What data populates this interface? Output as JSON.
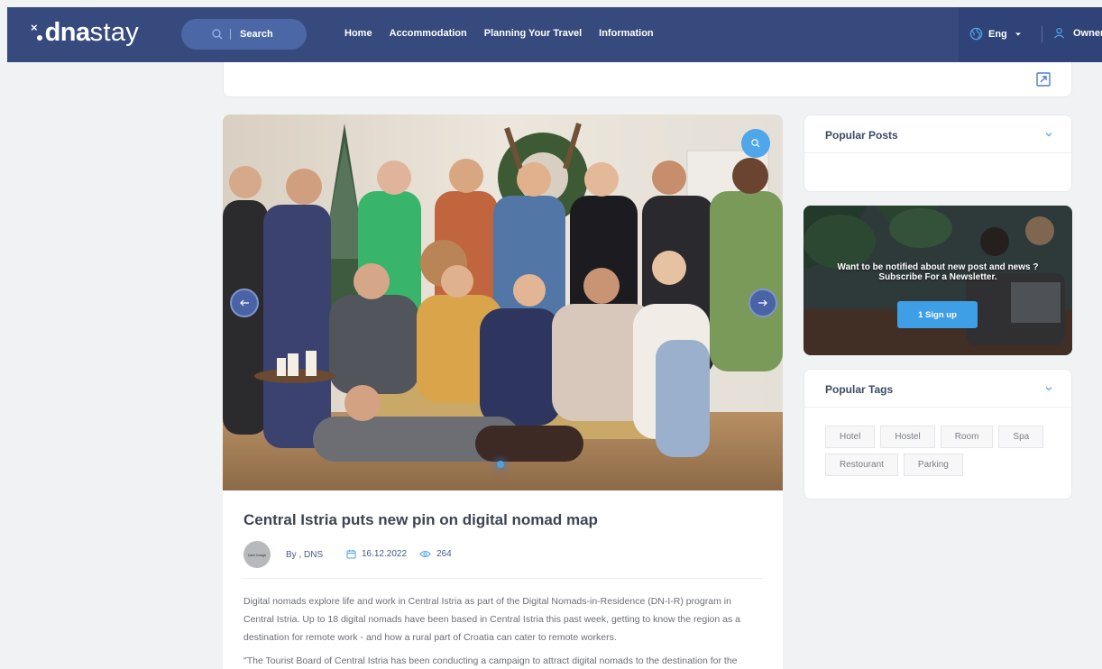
{
  "brand": {
    "logo_mark": "×",
    "logo_bold": "dna",
    "logo_thin": "stay"
  },
  "header": {
    "search_label": "Search",
    "nav": [
      "Home",
      "Accommodation",
      "Planning Your Travel",
      "Information"
    ],
    "language": "Eng",
    "owner_label": "Owner Log"
  },
  "icons": {
    "search": "search-icon",
    "globe": "globe-icon",
    "caret": "caret-down-icon",
    "user": "user-icon",
    "expand": "external-link-icon",
    "zoom": "zoom-icon",
    "prev": "arrow-left-icon",
    "next": "arrow-right-icon",
    "calendar": "calendar-icon",
    "views": "eye-icon",
    "chevron": "chevron-down-icon"
  },
  "article": {
    "title": "Central Istria puts new pin on digital nomad map",
    "avatar_text": "User image",
    "author": "By , DNS",
    "date": "16.12.2022",
    "views": "264",
    "paragraphs": [
      "Digital nomads explore life and work in Central Istria as part of the Digital Nomads-in-Residence (DN-I-R) program in Central Istria. Up to 18 digital nomads have been based in Central Istria this past week, getting to know the region as a destination for remote work - and how a rural part of Croatia can cater to remote workers.",
      "\"The Tourist Board of Central Istria has been conducting a campaign to attract digital nomads to the destination for the"
    ]
  },
  "sidebar": {
    "popular_posts_title": "Popular Posts",
    "newsletter_line1": "Want to be notified about new post and news ?",
    "newsletter_line2": "Subscribe For a Newsletter.",
    "signup_label": "1 Sign up",
    "popular_tags_title": "Popular Tags",
    "tags": [
      "Hotel",
      "Hostel",
      "Room",
      "Spa",
      "Restourant",
      "Parking"
    ]
  },
  "colors": {
    "navbar": "#364a7e",
    "accent_blue": "#3f9fe6",
    "page_bg": "#f1f2f4"
  }
}
